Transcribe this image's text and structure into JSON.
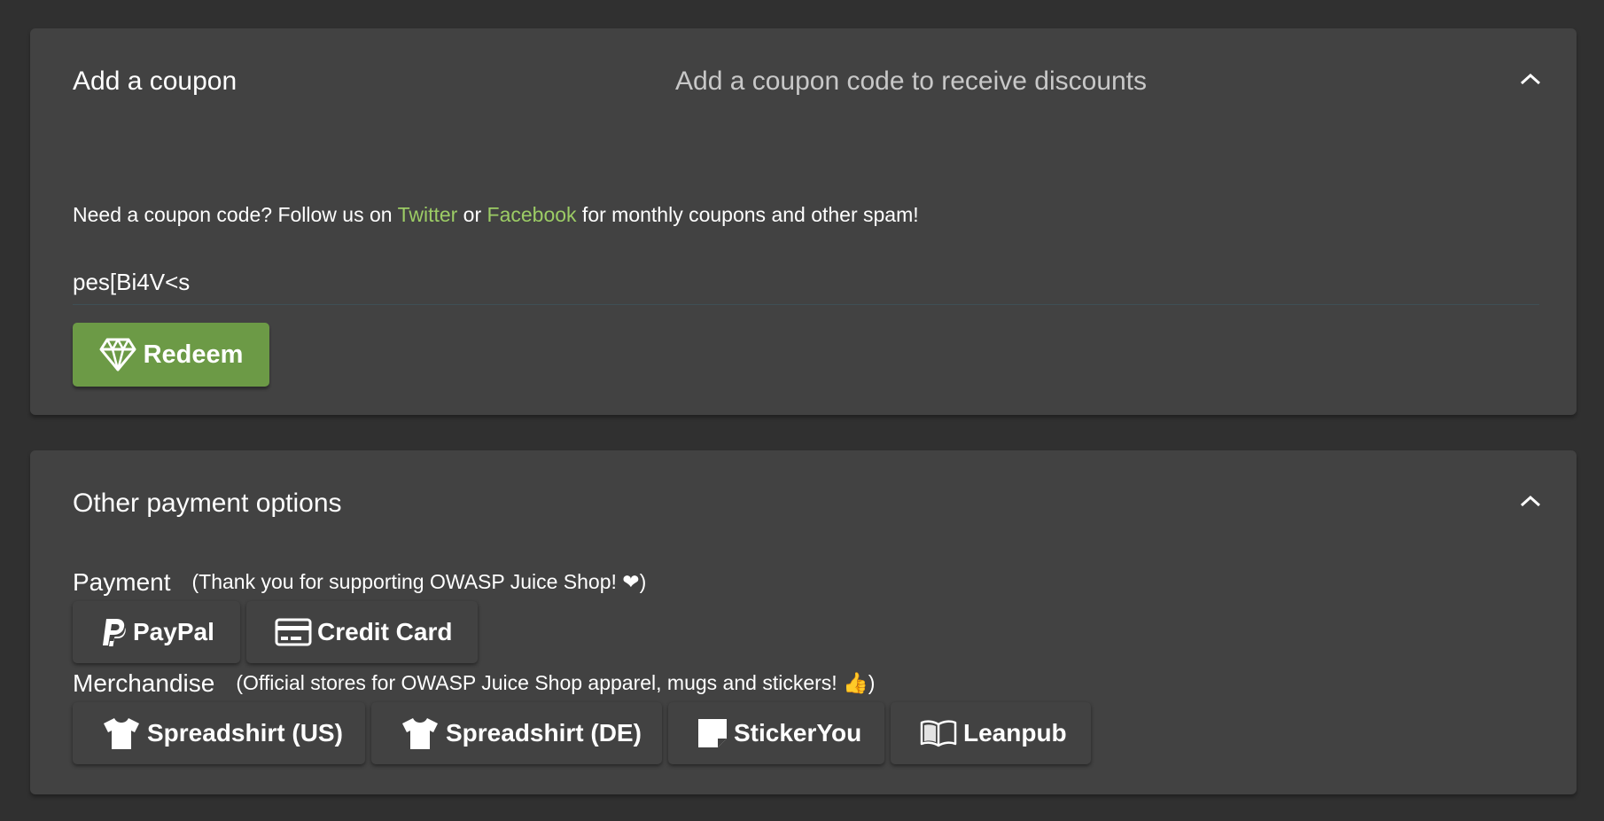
{
  "coupon": {
    "title": "Add a coupon",
    "description": "Add a coupon code to receive discounts",
    "hint_prefix": "Need a coupon code? Follow us on ",
    "hint_link_twitter": "Twitter",
    "hint_middle": " or ",
    "hint_link_facebook": "Facebook",
    "hint_suffix": " for monthly coupons and other spam!",
    "input_value": "pes[Bi4V<s",
    "redeem_label": "Redeem"
  },
  "payment_options": {
    "title": "Other payment options",
    "payment_label": "Payment",
    "payment_note": "(Thank you for supporting OWASP Juice Shop! ❤)",
    "payment_buttons": [
      {
        "label": "PayPal",
        "icon": "paypal-icon"
      },
      {
        "label": "Credit Card",
        "icon": "credit-card-icon"
      }
    ],
    "merch_label": "Merchandise",
    "merch_note": "(Official stores for OWASP Juice Shop apparel, mugs and stickers! 👍)",
    "merch_buttons": [
      {
        "label": "Spreadshirt (US)",
        "icon": "tshirt-icon"
      },
      {
        "label": "Spreadshirt (DE)",
        "icon": "tshirt-icon"
      },
      {
        "label": "StickerYou",
        "icon": "sticky-note-icon"
      },
      {
        "label": "Leanpub",
        "icon": "book-icon"
      }
    ]
  },
  "colors": {
    "background": "#303030",
    "panel": "#424242",
    "accent_green": "#6c9a46",
    "link_green": "#9ccc65"
  }
}
